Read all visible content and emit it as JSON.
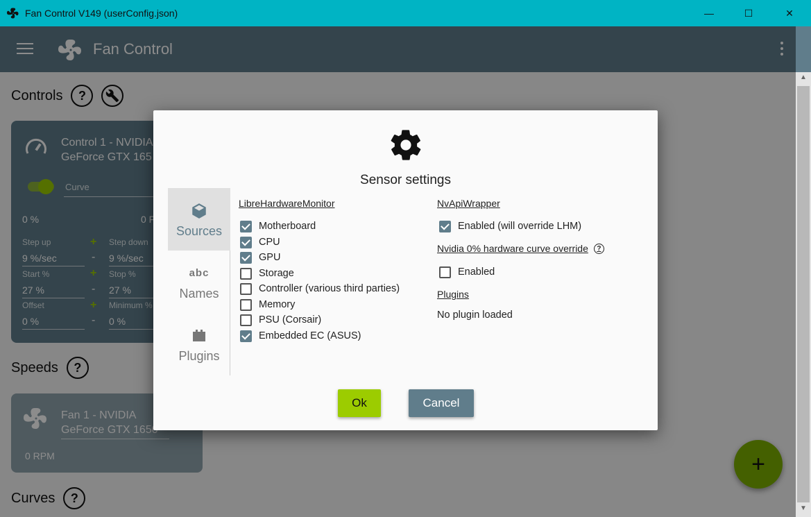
{
  "window": {
    "title": "Fan Control V149 (userConfig.json)",
    "min_glyph": "—",
    "max_glyph": "☐",
    "close_glyph": "✕"
  },
  "appbar": {
    "title": "Fan Control"
  },
  "sections": {
    "controls": "Controls",
    "speeds": "Speeds",
    "curves": "Curves",
    "help_glyph": "?"
  },
  "control_card": {
    "title_line1": "Control 1 - NVIDIA",
    "title_line2": "GeForce GTX 165",
    "curve_label": "Curve",
    "percent_left": "0 %",
    "percent_right": "0 F",
    "step_up_label": "Step up",
    "step_up_value": "9 %/sec",
    "step_down_label": "Step down",
    "step_down_value": "9 %/sec",
    "start_label": "Start %",
    "start_value": "27 %",
    "stop_label": "Stop %",
    "stop_value": "27 %",
    "offset_label": "Offset",
    "offset_value": "0 %",
    "minimum_label": "Minimum %",
    "minimum_value": "0 %",
    "plus": "+",
    "minus": "-"
  },
  "fan_card": {
    "title_line1": "Fan 1 - NVIDIA",
    "title_line2": "GeForce GTX 1650",
    "rpm": "0 RPM"
  },
  "fab_label": "+",
  "dialog": {
    "title": "Sensor settings",
    "nav": [
      {
        "label": "Sources",
        "icon": "cube-icon",
        "active": true
      },
      {
        "label": "Names",
        "icon": "abc-icon",
        "active": false
      },
      {
        "label": "Plugins",
        "icon": "plugin-icon",
        "active": false
      }
    ],
    "nav_abc_glyph": "abc",
    "lhm": {
      "header": "LibreHardwareMonitor",
      "items": [
        {
          "label": "Motherboard",
          "checked": true
        },
        {
          "label": "CPU",
          "checked": true
        },
        {
          "label": "GPU",
          "checked": true
        },
        {
          "label": "Storage",
          "checked": false
        },
        {
          "label": "Controller (various third parties)",
          "checked": false
        },
        {
          "label": "Memory",
          "checked": false
        },
        {
          "label": "PSU (Corsair)",
          "checked": false
        },
        {
          "label": "Embedded EC (ASUS)",
          "checked": true
        }
      ]
    },
    "nvapi": {
      "header": "NvApiWrapper",
      "enabled_label": "Enabled (will override LHM)",
      "enabled_checked": true
    },
    "nvidia_override": {
      "header": "Nvidia 0% hardware curve override",
      "enabled_label": "Enabled",
      "enabled_checked": false
    },
    "plugins": {
      "header": "Plugins",
      "status": "No plugin loaded"
    },
    "ok_label": "Ok",
    "cancel_label": "Cancel"
  },
  "colors": {
    "titlebar": "#00b4c4",
    "appbar": "#607d8b",
    "accent_green": "#9ccc00",
    "checkbox": "#607d8b"
  }
}
